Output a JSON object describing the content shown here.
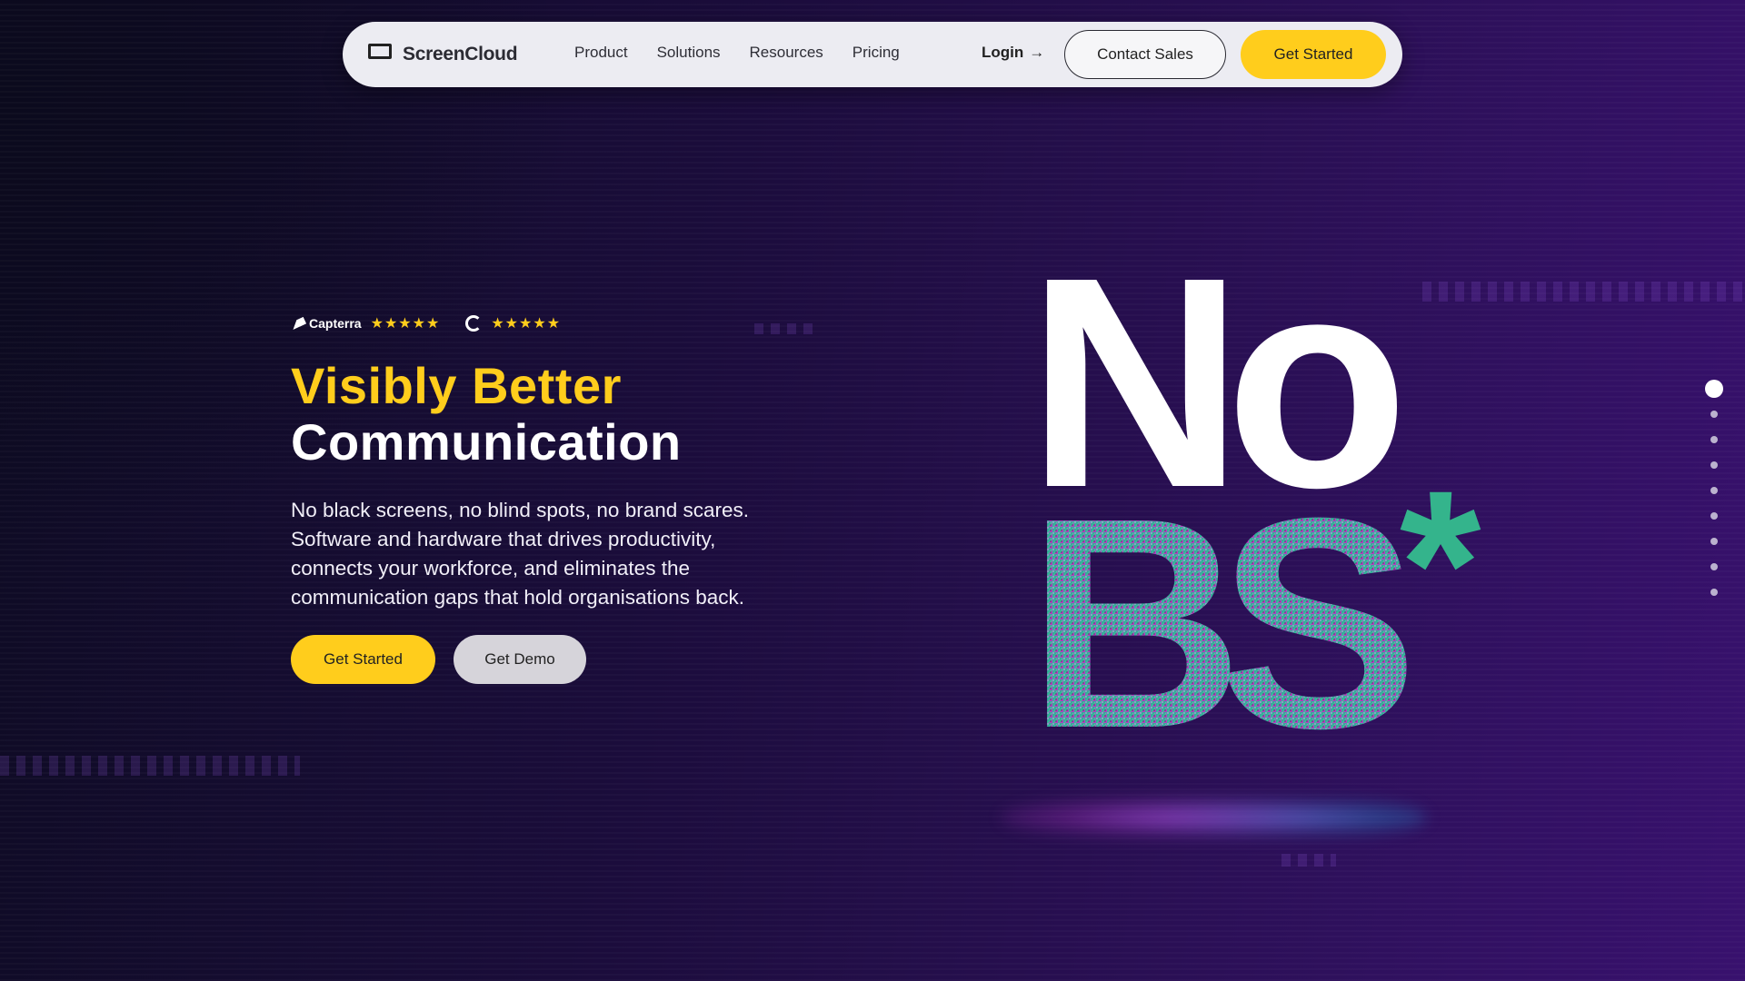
{
  "brand": {
    "name": "ScreenCloud",
    "accent": "#ffcd1c"
  },
  "nav": {
    "items": [
      {
        "label": "Product"
      },
      {
        "label": "Solutions"
      },
      {
        "label": "Resources"
      },
      {
        "label": "Pricing"
      }
    ],
    "login_label": "Login",
    "login_icon": "arrow-right-icon",
    "contact_label": "Contact Sales",
    "get_started_label": "Get Started"
  },
  "ratings": {
    "capterra": {
      "label": "Capterra",
      "stars": "★★★★★",
      "icon": "capterra-arrow-icon"
    },
    "g2": {
      "icon": "g2-logo-icon",
      "stars": "★★★★★"
    }
  },
  "hero": {
    "headline_highlight": "Visibly Better",
    "headline_rest": "Communication",
    "description": "No black screens, no blind spots, no brand scares. Software and hardware that drives productivity, connects your workforce, and eliminates the communication gaps that hold organisations back.",
    "primary_cta": "Get Started",
    "secondary_cta": "Get Demo"
  },
  "graphic": {
    "top_text": "No",
    "bottom_text": "BS",
    "mark": "*"
  },
  "pagination": {
    "total": 9,
    "active_index": 0
  }
}
